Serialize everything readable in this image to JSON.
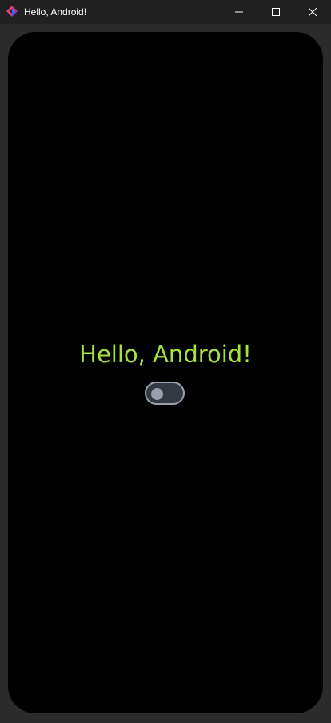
{
  "window": {
    "title": "Hello, Android!",
    "icon": "app-logo-icon"
  },
  "controls": {
    "minimize_icon": "minimize-icon",
    "maximize_icon": "maximize-icon",
    "close_icon": "close-icon"
  },
  "app": {
    "greeting": "Hello, Android!",
    "switch": {
      "checked": false
    }
  },
  "colors": {
    "titlebar_bg": "#202020",
    "frame_bg": "#2b2b2b",
    "screen_bg": "#000000",
    "greeting_text": "#a6e23a",
    "switch_track": "#343a44",
    "switch_outline": "#9aa0ab",
    "icon_pink": "#e8407a",
    "icon_blue": "#3a7be0"
  }
}
